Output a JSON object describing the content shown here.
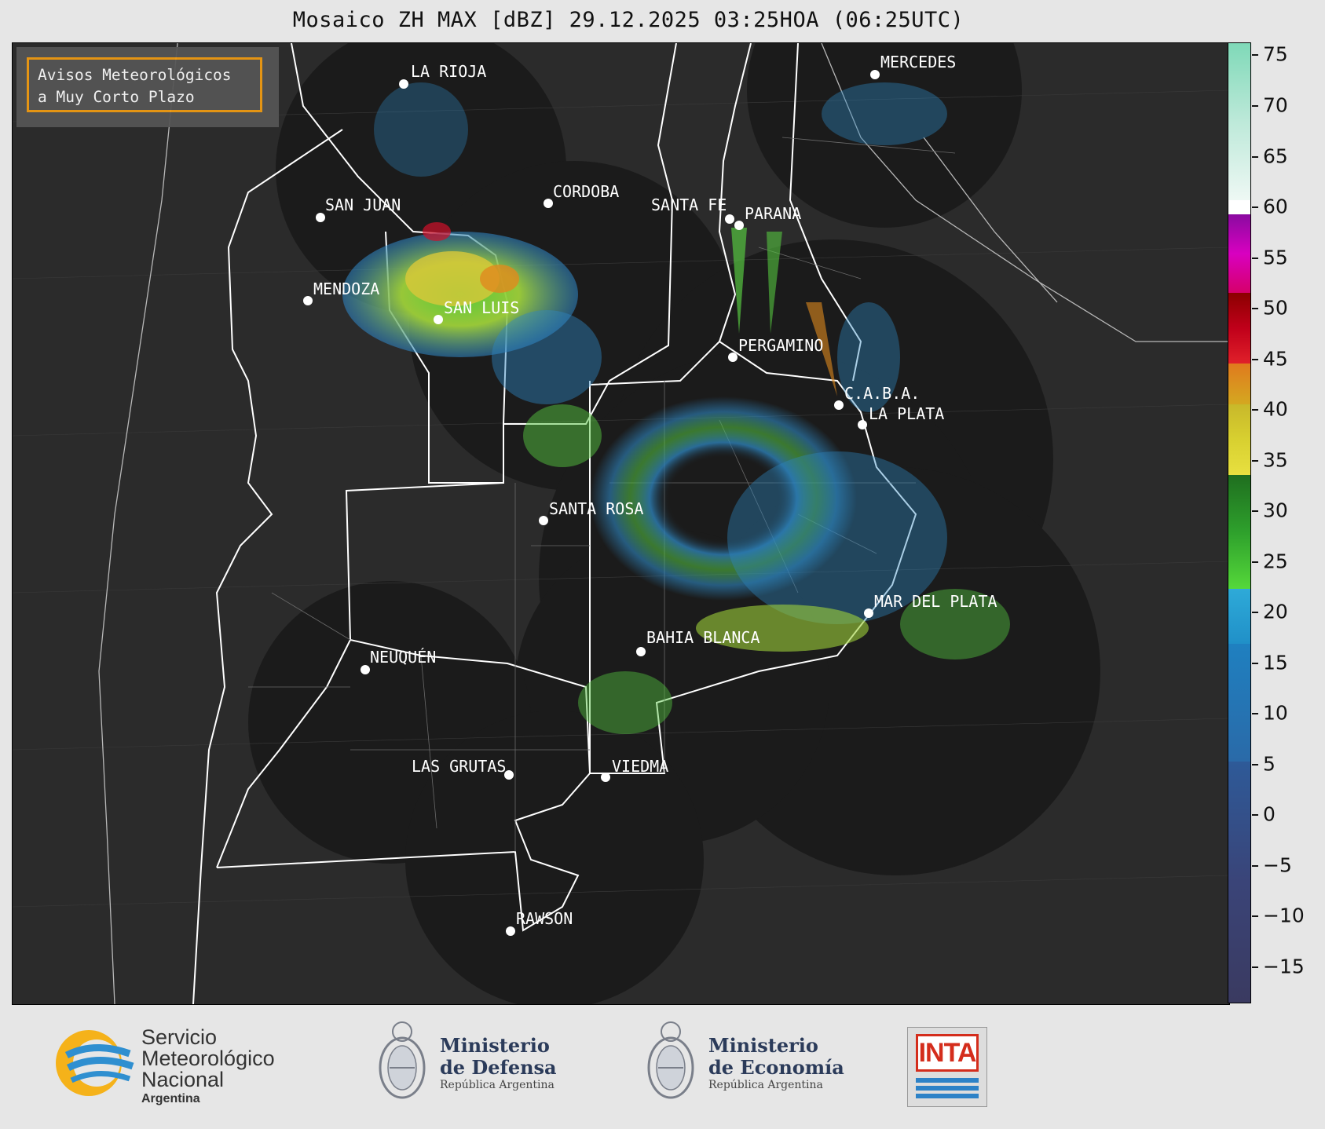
{
  "title": "Mosaico ZH MAX [dBZ] 29.12.2025 03:25HOA (06:25UTC)",
  "avisos": {
    "line1": "Avisos Meteorológicos",
    "line2": "a Muy Corto Plazo"
  },
  "cities": [
    {
      "name": "LA RIOJA"
    },
    {
      "name": "SAN JUAN"
    },
    {
      "name": "CORDOBA"
    },
    {
      "name": "SANTA FE"
    },
    {
      "name": "PARANA"
    },
    {
      "name": "MERCEDES"
    },
    {
      "name": "MENDOZA"
    },
    {
      "name": "SAN LUIS"
    },
    {
      "name": "PERGAMINO"
    },
    {
      "name": "C.A.B.A."
    },
    {
      "name": "LA PLATA"
    },
    {
      "name": "SANTA ROSA"
    },
    {
      "name": "MAR DEL PLATA"
    },
    {
      "name": "BAHIA BLANCA"
    },
    {
      "name": "NEUQUÉN"
    },
    {
      "name": "LAS GRUTAS"
    },
    {
      "name": "VIEDMA"
    },
    {
      "name": "RAWSON"
    }
  ],
  "colorbar": {
    "ticks": [
      "75",
      "70",
      "65",
      "60",
      "55",
      "50",
      "45",
      "40",
      "35",
      "30",
      "25",
      "20",
      "15",
      "10",
      "5",
      "0",
      "−5",
      "−10",
      "−15"
    ],
    "colors": {
      "negative": "#3a3f6e",
      "blue": "#1f77b4",
      "green": "#2ca02c",
      "yellow": "#d6c82a",
      "orange": "#e08a1e",
      "red": "#d0102a",
      "magenta": "#d800c0",
      "teal": "#8ad9c0"
    }
  },
  "logos": {
    "smn": {
      "line1": "Servicio",
      "line2": "Meteorológico",
      "line3": "Nacional",
      "line4": "Argentina"
    },
    "defensa": {
      "line1": "Ministerio",
      "line2": "de Defensa",
      "line3": "República Argentina"
    },
    "economia": {
      "line1": "Ministerio",
      "line2": "de Economía",
      "line3": "República Argentina"
    },
    "inta": {
      "word": "INTA"
    }
  }
}
